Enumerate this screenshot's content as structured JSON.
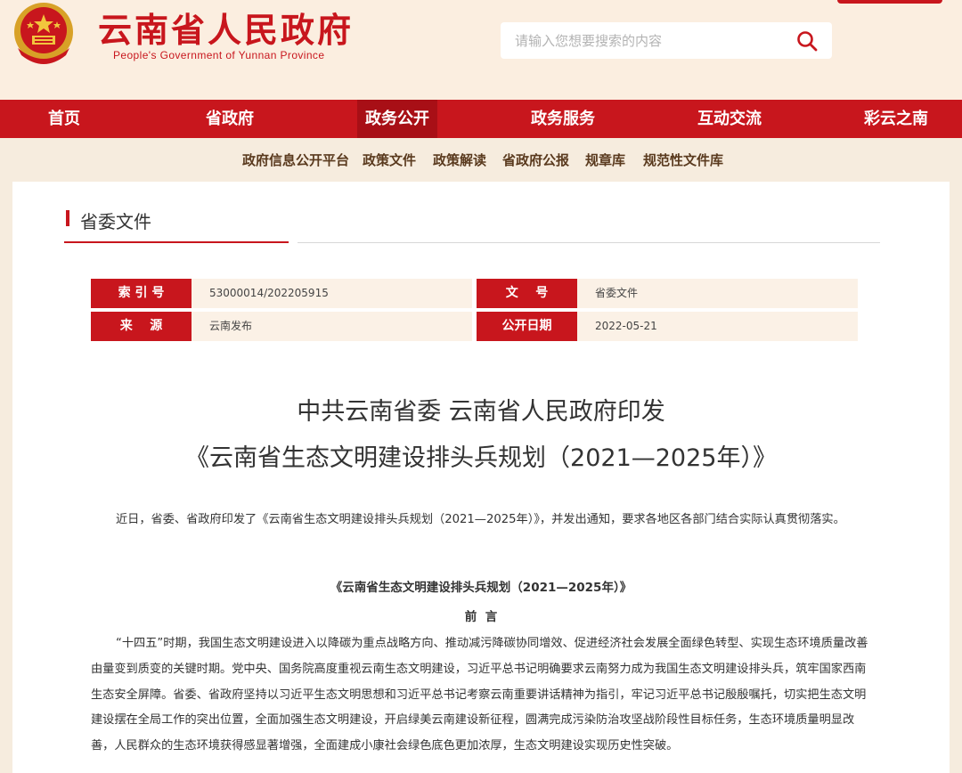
{
  "header": {
    "site_title": "云南省人民政府",
    "site_subtitle": "People's Government of Yunnan Province",
    "search_placeholder": "请输入您想要搜索的内容"
  },
  "mainnav": [
    {
      "label": "首页"
    },
    {
      "label": "省政府"
    },
    {
      "label": "政务公开",
      "active": true
    },
    {
      "label": "政务服务"
    },
    {
      "label": "互动交流"
    },
    {
      "label": "彩云之南"
    }
  ],
  "subnav": [
    {
      "label": "政府信息公开平台"
    },
    {
      "label": "政策文件"
    },
    {
      "label": "政策解读"
    },
    {
      "label": "省政府公报"
    },
    {
      "label": "规章库"
    },
    {
      "label": "规范性文件库"
    }
  ],
  "section": {
    "title": "省委文件"
  },
  "meta": {
    "index_label": "索 引 号",
    "index_value": "53000014/202205915",
    "doc_label": "文    号",
    "doc_value": "省委文件",
    "source_label": "来    源",
    "source_value": "云南发布",
    "date_label": "公开日期",
    "date_value": "2022-05-21"
  },
  "article": {
    "title_line1": "中共云南省委 云南省人民政府印发",
    "title_line2": "《云南省生态文明建设排头兵规划（2021—2025年）》",
    "intro": "近日，省委、省政府印发了《云南省生态文明建设排头兵规划（2021—2025年）》，并发出通知，要求各地区各部门结合实际认真贯彻落实。",
    "doc_heading": "《云南省生态文明建设排头兵规划（2021—2025年）》",
    "preface_heading": "前  言",
    "body": "“十四五”时期，我国生态文明建设进入以降碳为重点战略方向、推动减污降碳协同增效、促进经济社会发展全面绿色转型、实现生态环境质量改善由量变到质变的关键时期。党中央、国务院高度重视云南生态文明建设，习近平总书记明确要求云南努力成为我国生态文明建设排头兵，筑牢国家西南生态安全屏障。省委、省政府坚持以习近平生态文明思想和习近平总书记考察云南重要讲话精神为指引，牢记习近平总书记殷殷嘱托，切实把生态文明建设摆在全局工作的突出位置，全面加强生态文明建设，开启绿美云南建设新征程，圆满完成污染防治攻坚战阶段性目标任务，生态环境质量明显改善，人民群众的生态环境获得感显著增强，全面建成小康社会绿色底色更加浓厚，生态文明建设实现历史性突破。"
  },
  "colors": {
    "brand_red": "#c8161d",
    "page_bg": "#f6ecde",
    "meta_bg": "#fbf1e6"
  }
}
